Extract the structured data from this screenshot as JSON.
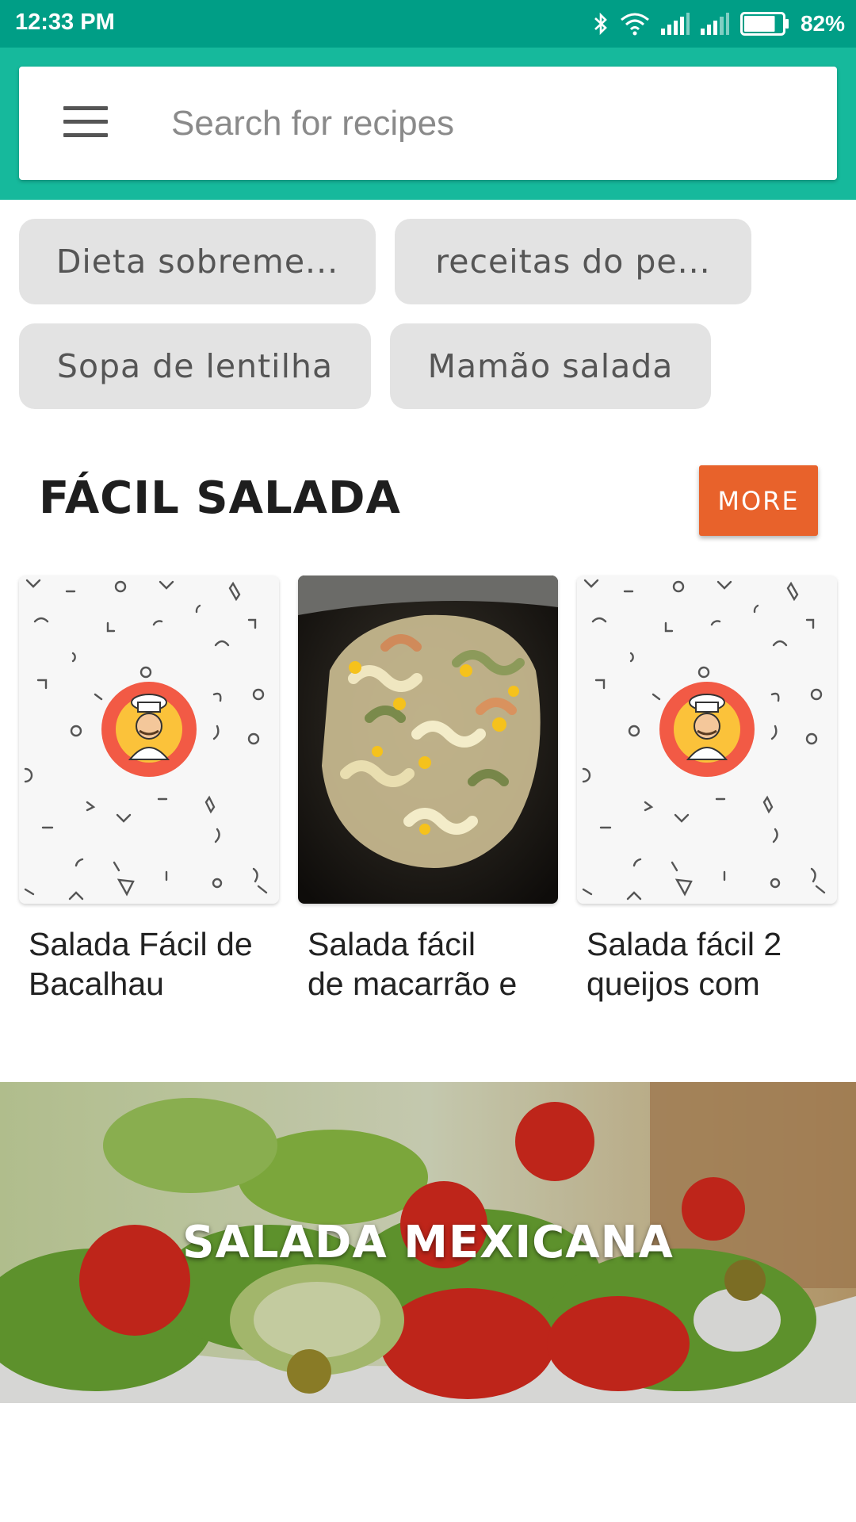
{
  "status_bar": {
    "time": "12:33 PM",
    "battery_percent": "82%",
    "battery_level": 0.82,
    "icons": [
      "bluetooth-icon",
      "wifi-icon",
      "signal-icon",
      "signal-icon-2",
      "battery-icon"
    ]
  },
  "search": {
    "placeholder": "Search for recipes",
    "value": "",
    "menu_icon": "menu-icon"
  },
  "chips": [
    "Dieta sobreme...",
    "receitas do pe...",
    "Sopa de lentilha",
    "Mamão salada"
  ],
  "section": {
    "title": "FÁCIL SALADA",
    "more_label": "MORE",
    "cards": [
      {
        "line1": "Salada Fácil de",
        "line2": "Bacalhau",
        "image": "chef-placeholder"
      },
      {
        "line1": "Salada fácil",
        "line2": "de macarrão e",
        "image": "pasta-salad-photo"
      },
      {
        "line1": "Salada fácil 2",
        "line2": "queijos com",
        "image": "chef-placeholder"
      }
    ]
  },
  "banner": {
    "title": "SALADA MEXICANA",
    "image": "salad-photo"
  },
  "colors": {
    "status_bar": "#009e86",
    "app_bar": "#16b99c",
    "chip_bg": "#e3e3e3",
    "more_button": "#e8622b",
    "chef_badge": "#f25a45"
  }
}
